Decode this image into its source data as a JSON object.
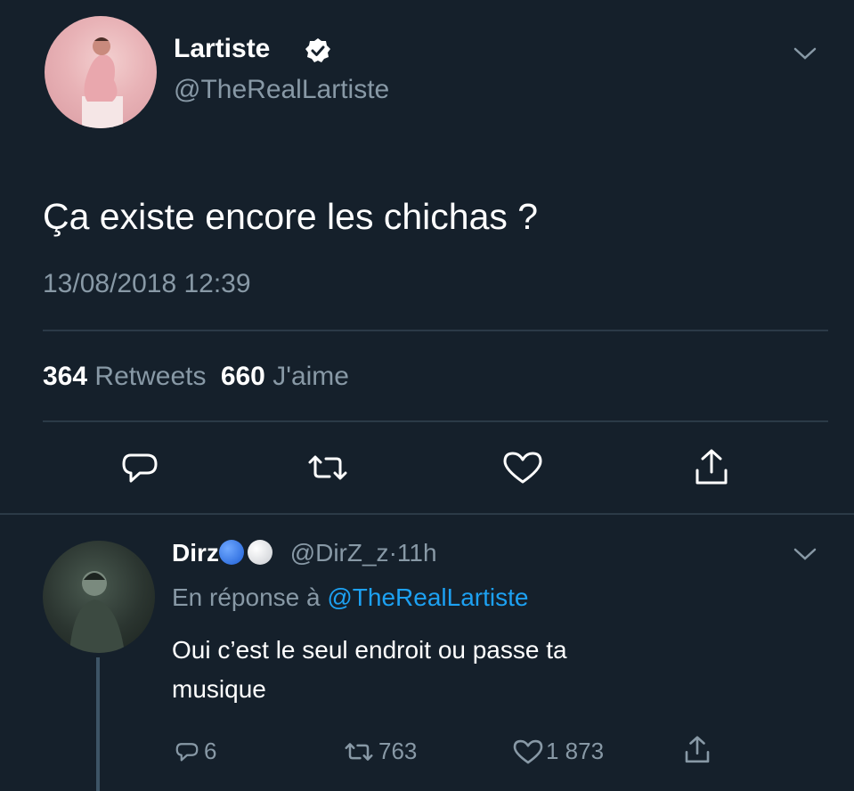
{
  "tweet": {
    "author_name": "Lartiste",
    "author_handle": "@TheRealLartiste",
    "verified_icon": "verified-badge-icon",
    "text": "Ça existe encore les chichas ?",
    "timestamp": "13/08/2018 12:39",
    "retweets_count": "364",
    "retweets_label": "Retweets",
    "likes_count": "660",
    "likes_label": "J'aime",
    "actions": [
      "reply-icon",
      "retweet-icon",
      "like-icon",
      "share-icon"
    ]
  },
  "reply": {
    "author_name": "Dirz",
    "author_handle": "@DirZ_z",
    "separator": "·",
    "time": "11h",
    "reply_prefix": "En réponse à",
    "reply_to": "@TheRealLartiste",
    "text_line1": "Oui c’est le seul endroit ou passe ta",
    "text_line2": "musique",
    "reply_count": "6",
    "retweet_count": "763",
    "like_count": "1 873"
  },
  "colors": {
    "background": "#15202b",
    "muted": "#8899a6",
    "link": "#1da1f2"
  }
}
